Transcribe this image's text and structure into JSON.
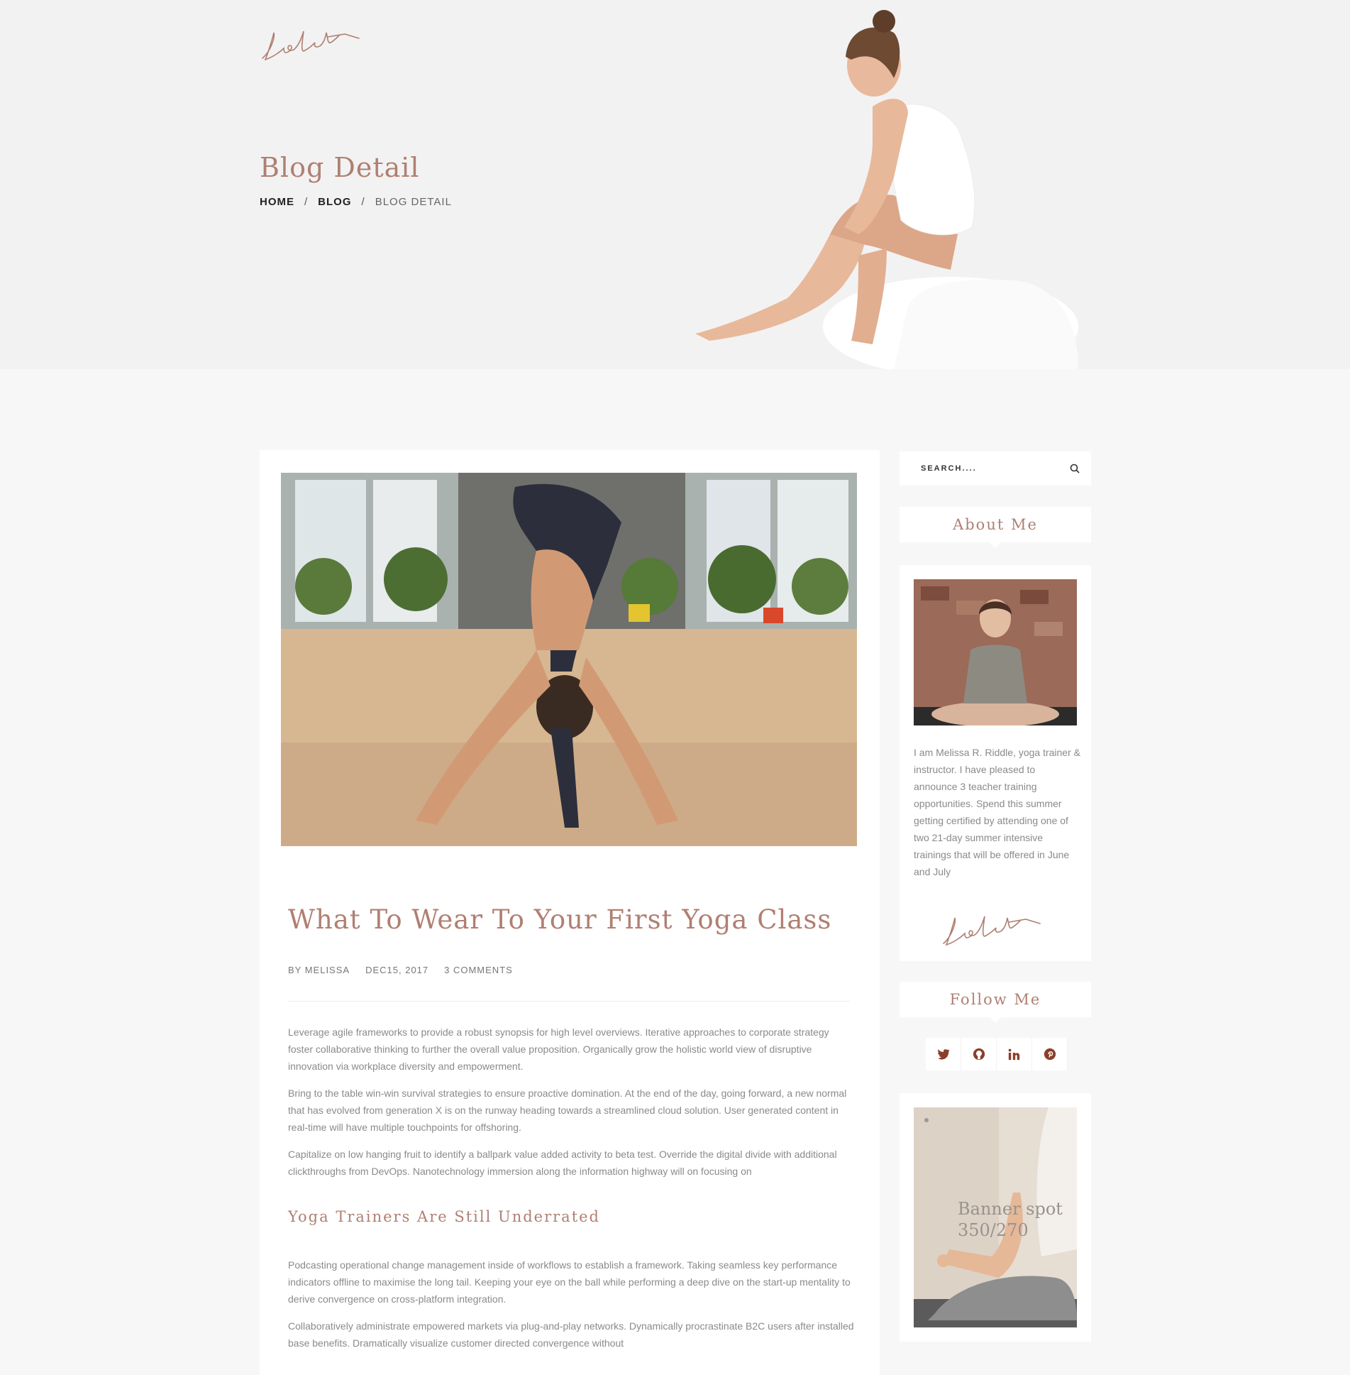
{
  "header": {
    "logo_text": "LeoCraft",
    "page_title": "Blog Detail",
    "breadcrumb": {
      "home": "HOME",
      "blog": "BLOG",
      "current": "BLOG DETAIL",
      "separator": "/"
    }
  },
  "post": {
    "title": "What To Wear To Your First Yoga Class",
    "meta": {
      "author": "BY MELISSA",
      "date": "DEC15, 2017",
      "comments": "3 COMMENTS"
    },
    "paragraphs": [
      "Leverage agile frameworks to provide a robust synopsis for high level overviews. Iterative approaches to corporate strategy foster collaborative thinking to further the overall value proposition. Organically grow the holistic world view of disruptive innovation via workplace diversity and empowerment.",
      "Bring to the table win-win survival strategies to ensure proactive domination. At the end of the day, going forward, a new normal that has evolved from generation X is on the runway heading towards a streamlined cloud solution. User generated content in real-time will have multiple touchpoints for offshoring.",
      "Capitalize on low hanging fruit to identify a ballpark value added activity to beta test. Override the digital divide with additional clickthroughs from DevOps. Nanotechnology immersion along the information highway will on focusing on"
    ],
    "subheading": "Yoga Trainers Are Still Underrated",
    "paragraphs_2": [
      "Podcasting operational change management inside of workflows to establish a framework. Taking seamless key performance indicators offline to maximise the long tail. Keeping your eye on the ball while performing a deep dive on the start-up mentality to derive convergence on cross-platform integration.",
      "Collaboratively administrate empowered markets via plug-and-play networks. Dynamically procrastinate B2C users after installed base benefits. Dramatically visualize customer directed convergence without"
    ]
  },
  "sidebar": {
    "search": {
      "placeholder": "SEARCH...."
    },
    "about": {
      "title": "About Me",
      "text": "I am Melissa R. Riddle, yoga trainer & instructor. I have pleased to announce 3 teacher training opportunities. Spend this summer getting certified by attending one of two 21-day summer intensive trainings that will be offered in June and July"
    },
    "follow": {
      "title": "Follow Me",
      "icons": [
        "twitter-icon",
        "github-icon",
        "linkedin-icon",
        "pinterest-icon"
      ],
      "glyphs": [
        "🐦",
        "◉",
        "in",
        "℗"
      ]
    },
    "banner": {
      "line1": "Banner spot",
      "line2": "350/270"
    }
  },
  "colors": {
    "accent": "#b07f72",
    "icon": "#8a3f2a",
    "page_bg": "#f7f7f7",
    "hero_bg": "#f2f2f2"
  }
}
